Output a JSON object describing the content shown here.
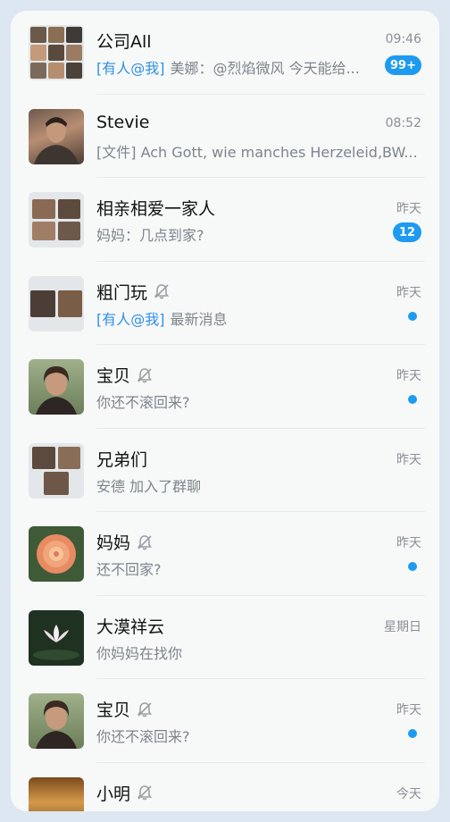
{
  "chats": [
    {
      "name": "公司All",
      "time": "09:46",
      "mention": "[有人@我]",
      "preview": "美娜：@烈焰微风 今天能给...",
      "badge": "99+",
      "muted": false,
      "avatar": "group-photo-grid-9"
    },
    {
      "name": "Stevie",
      "time": "08:52",
      "mention": "",
      "preview": "[文件] Ach Gott, wie manches Herzeleid,BW...",
      "badge": "",
      "muted": false,
      "avatar": "portrait-man"
    },
    {
      "name": "相亲相爱一家人",
      "time": "昨天",
      "mention": "",
      "preview": "妈妈：几点到家?",
      "badge": "12",
      "muted": false,
      "avatar": "group-photo-grid-4"
    },
    {
      "name": "粗门玩",
      "time": "昨天",
      "mention": "[有人@我]",
      "preview": "最新消息",
      "badge": "",
      "dot": true,
      "muted": true,
      "avatar": "group-photo-pair"
    },
    {
      "name": "宝贝",
      "time": "昨天",
      "mention": "",
      "preview": "你还不滚回来?",
      "badge": "",
      "dot": true,
      "muted": true,
      "avatar": "portrait-woman"
    },
    {
      "name": "兄弟们",
      "time": "昨天",
      "mention": "",
      "preview": "安德 加入了群聊",
      "badge": "",
      "muted": false,
      "avatar": "group-photo-grid-3"
    },
    {
      "name": "妈妈",
      "time": "昨天",
      "mention": "",
      "preview": "还不回家?",
      "badge": "",
      "dot": true,
      "muted": true,
      "avatar": "rose-flower"
    },
    {
      "name": "大漠祥云",
      "time": "星期日",
      "mention": "",
      "preview": "你妈妈在找你",
      "badge": "",
      "muted": false,
      "avatar": "lotus-flower"
    },
    {
      "name": "宝贝",
      "time": "昨天",
      "mention": "",
      "preview": "你还不滚回来?",
      "badge": "",
      "dot": true,
      "muted": true,
      "avatar": "portrait-woman"
    },
    {
      "name": "小明",
      "time": "今天",
      "mention": "",
      "preview": "",
      "badge": "",
      "muted": true,
      "avatar": "sunset-landscape"
    }
  ],
  "colors": {
    "accent": "#1e9bf0",
    "mention": "#2f8fe6",
    "muted_icon": "#9aa0a6"
  }
}
